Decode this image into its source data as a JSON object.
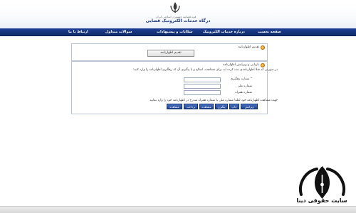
{
  "header": {
    "subtitle": "قوه قضائیه جمهوری اسلامی ایران",
    "title": "درگاه خدمات الکترونیک قضایی",
    "emblem_icon": "iran-emblem-icon"
  },
  "nav": {
    "items": [
      {
        "label": "صفحه نخست"
      },
      {
        "label": "درباره خدمات الکترونیک"
      },
      {
        "label": "شکایات و پیشنهادات"
      },
      {
        "label": "سوالات متداول"
      },
      {
        "label": "ارتباط با ما"
      }
    ]
  },
  "submit_panel": {
    "title": "تقدیم اظهارنامه",
    "button_label": "تقدیم اظهارنامه"
  },
  "review_panel": {
    "title": "بازیابی و ویرایش اظهارنامه",
    "note": "در صورتی که قبلا اظهارنامه‌ی ثبت کرده اید برای مشاهده، اصلاح و یا پیگیری آن کد رهگیری اظهارنامه را وارد کنید:",
    "fields": [
      {
        "label": "* شماره رهگیری",
        "value": ""
      },
      {
        "label": "شماره ملی",
        "value": ""
      },
      {
        "label": "شماره همراه",
        "value": ""
      }
    ],
    "guide": "جهت مشاهده اظهارنامه خود لطفا شماره ملی یا شماره همراه مندرج در اظهارنامه خود را وارد نمایید",
    "actions": [
      "ویرایش",
      "چاپ",
      "پیگیری",
      "مشاهده",
      "پرداخت",
      "مشاهده"
    ]
  },
  "watermark": {
    "text": "سایت حقوقی دینا",
    "logo_icon": "pen-nib-logo-icon"
  },
  "colors": {
    "nav_bg": "#1d3e93",
    "title_blue": "#1b3b86",
    "panel_icon": "#e88a00",
    "button_blue": "#2b52a4"
  }
}
